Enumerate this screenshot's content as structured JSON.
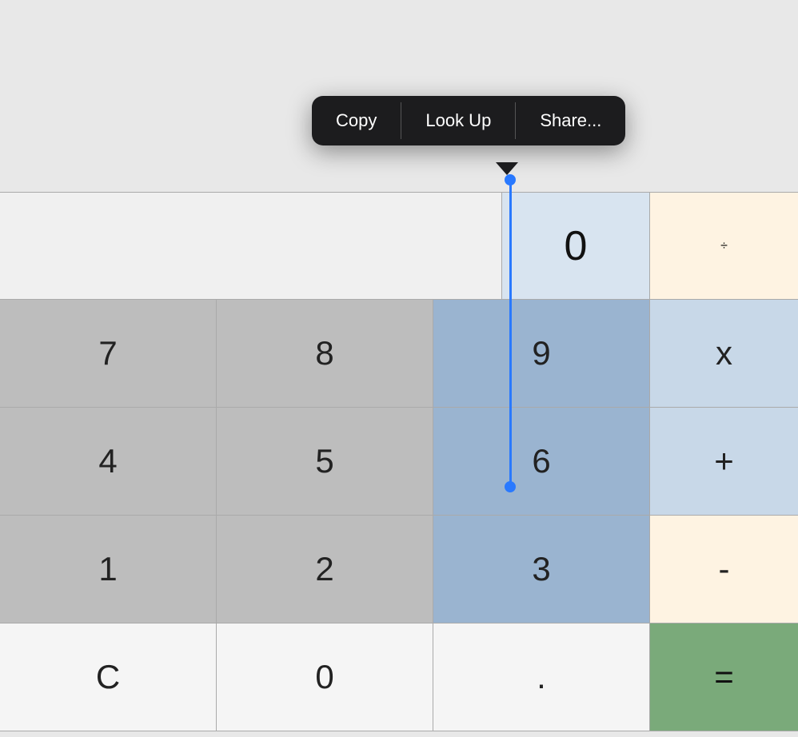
{
  "contextMenu": {
    "items": [
      {
        "id": "copy",
        "label": "Copy"
      },
      {
        "id": "lookup",
        "label": "Look Up"
      },
      {
        "id": "share",
        "label": "Share..."
      }
    ]
  },
  "display": {
    "value": "0"
  },
  "calculator": {
    "rows": [
      {
        "id": "row-789",
        "cells": [
          {
            "id": "7",
            "label": "7",
            "type": "num"
          },
          {
            "id": "8",
            "label": "8",
            "type": "num"
          },
          {
            "id": "9",
            "label": "9",
            "type": "num-selected"
          },
          {
            "id": "mul",
            "label": "x",
            "type": "op"
          }
        ]
      },
      {
        "id": "row-456",
        "cells": [
          {
            "id": "4",
            "label": "4",
            "type": "num"
          },
          {
            "id": "5",
            "label": "5",
            "type": "num"
          },
          {
            "id": "6",
            "label": "6",
            "type": "num-selected"
          },
          {
            "id": "add",
            "label": "+",
            "type": "op"
          }
        ]
      },
      {
        "id": "row-123",
        "cells": [
          {
            "id": "1",
            "label": "1",
            "type": "num"
          },
          {
            "id": "2",
            "label": "2",
            "type": "num"
          },
          {
            "id": "3",
            "label": "3",
            "type": "num-selected"
          },
          {
            "id": "sub",
            "label": "-",
            "type": "op-orange"
          }
        ]
      },
      {
        "id": "row-bottom",
        "cells": [
          {
            "id": "clear",
            "label": "C",
            "type": "clear"
          },
          {
            "id": "0",
            "label": "0",
            "type": "zero"
          },
          {
            "id": "dot",
            "label": ".",
            "type": "dot"
          },
          {
            "id": "eq",
            "label": "=",
            "type": "equals"
          }
        ]
      }
    ],
    "divSymbol": "÷"
  }
}
